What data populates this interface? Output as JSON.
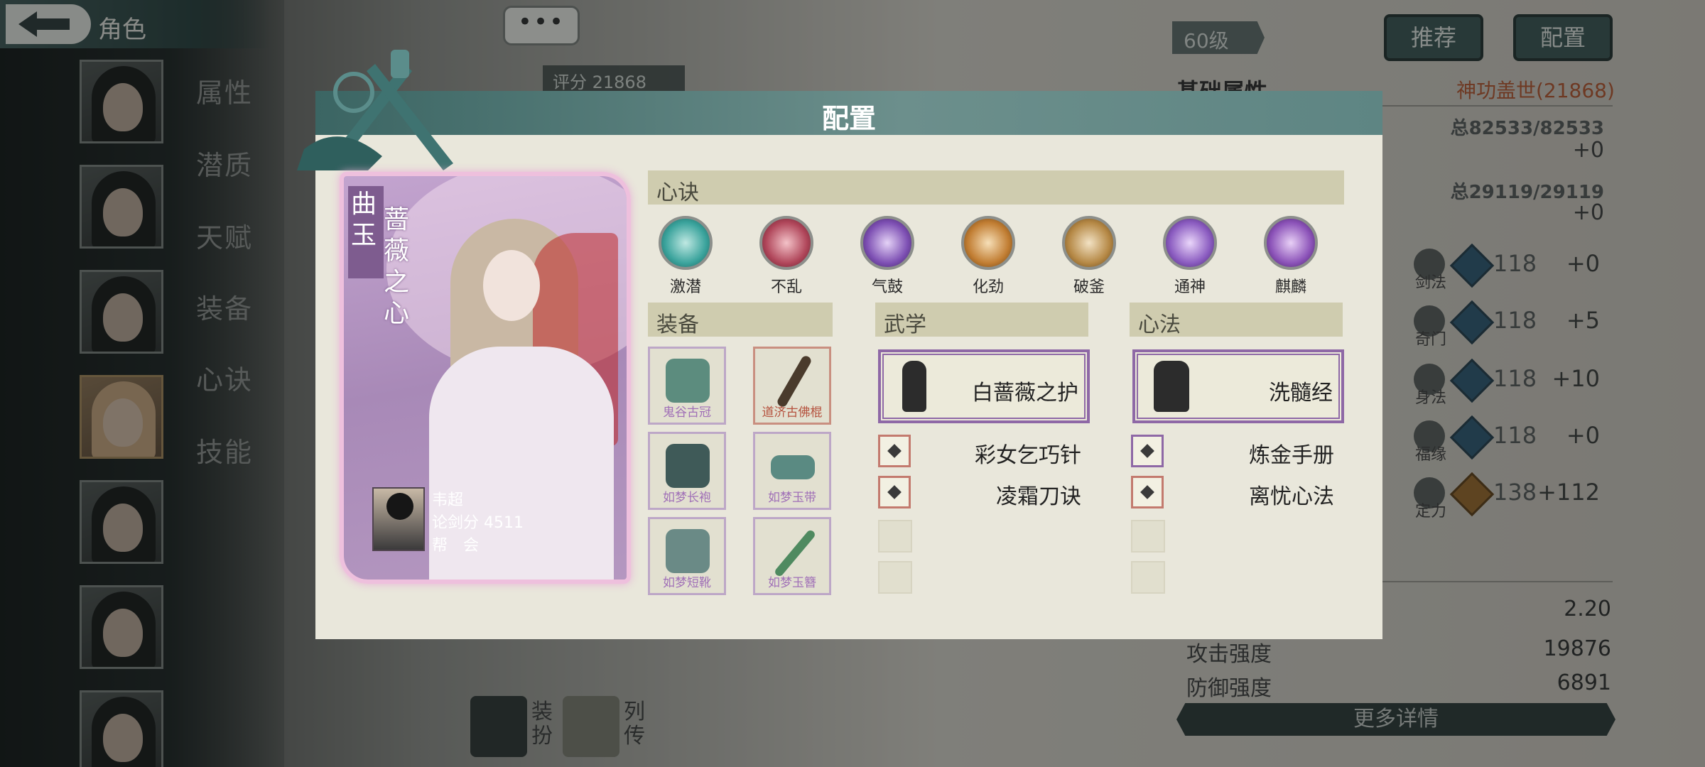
{
  "header": {
    "title": "角色"
  },
  "sidebar": {
    "menu": [
      "属性",
      "潜质",
      "天赋",
      "装备",
      "心诀",
      "技能"
    ]
  },
  "background": {
    "bubble_text": "•••",
    "score_label": "评分 21868",
    "level": "60级",
    "buttons": {
      "recommend": "推荐",
      "config": "配置"
    },
    "base_attr_title": "基础属性",
    "god_power": "神功盖世(21868)",
    "totals": [
      {
        "total": "总82533/82533",
        "plus": "+0"
      },
      {
        "total": "总29119/29119",
        "plus": "+0"
      }
    ],
    "skills": [
      {
        "label": "剑法",
        "value": "118",
        "add": "+0"
      },
      {
        "label": "奇门",
        "value": "118",
        "add": "+5"
      },
      {
        "label": "身法",
        "value": "118",
        "add": "+10"
      },
      {
        "label": "福缘",
        "value": "118",
        "add": "+0"
      },
      {
        "label": "定力",
        "value": "138",
        "add": "+112"
      }
    ],
    "stats": [
      {
        "label": "",
        "value": "2.20"
      },
      {
        "label": "攻击强度",
        "value": "19876"
      },
      {
        "label": "防御强度",
        "value": "6891"
      }
    ],
    "more_details": "更多详情",
    "bottom_tabs": {
      "dress": "装扮",
      "bio": "列传"
    }
  },
  "modal": {
    "title": "配置",
    "card": {
      "name": "曲玉",
      "title": "蔷薇之心",
      "player_name": "韦超",
      "score_label": "论剑分",
      "score": "4511",
      "guild_label": "帮　会"
    },
    "sections": {
      "xinjue": "心诀",
      "zhuangbei": "装备",
      "wuxue": "武学",
      "xinfa": "心法"
    },
    "xinjue": [
      {
        "name": "激潜",
        "color": "#3aa39c"
      },
      {
        "name": "不乱",
        "color": "#b0465a"
      },
      {
        "name": "气鼓",
        "color": "#7d4fb3"
      },
      {
        "name": "化劲",
        "color": "#c17d32"
      },
      {
        "name": "破釜",
        "color": "#b58845"
      },
      {
        "name": "通神",
        "color": "#8a5bc0"
      },
      {
        "name": "麒麟",
        "color": "#8b52b8"
      }
    ],
    "equipment": [
      {
        "name": "鬼谷古冠",
        "rarity": "purple"
      },
      {
        "name": "道济古佛棍",
        "rarity": "red"
      },
      {
        "name": "如梦长袍",
        "rarity": "purple"
      },
      {
        "name": "如梦玉带",
        "rarity": "purple"
      },
      {
        "name": "如梦短靴",
        "rarity": "purple"
      },
      {
        "name": "如梦玉簪",
        "rarity": "purple"
      }
    ],
    "wuxue": {
      "main": "白蔷薇之护",
      "subs": [
        "彩女乞巧针",
        "凌霜刀诀"
      ]
    },
    "xinfa": {
      "main": "洗髓经",
      "subs": [
        "炼金手册",
        "离忧心法"
      ]
    }
  }
}
